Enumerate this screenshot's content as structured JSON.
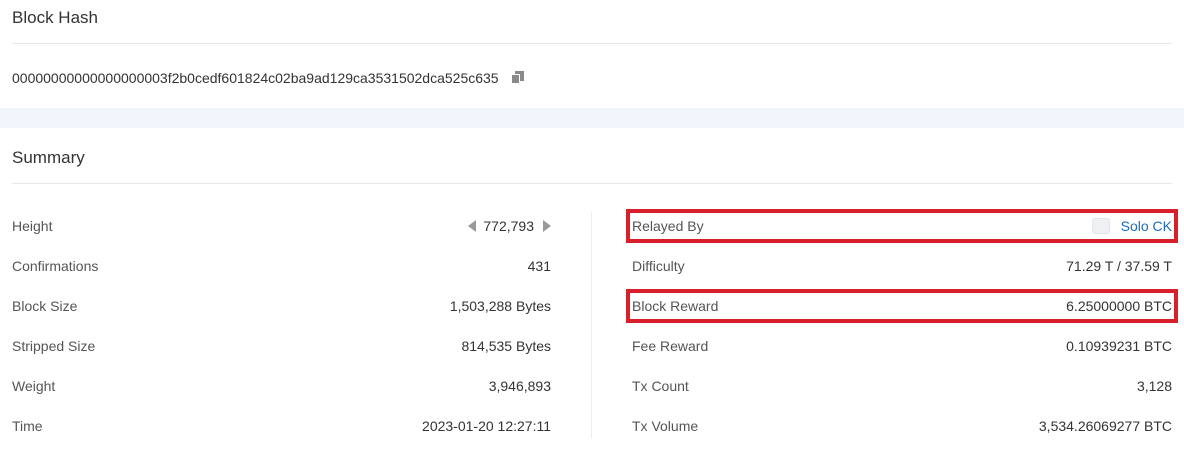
{
  "block_hash": {
    "title": "Block Hash",
    "value": "00000000000000000003f2b0cedf601824c02ba9ad129ca3531502dca525c635",
    "copy_icon": "copy-icon"
  },
  "summary": {
    "title": "Summary",
    "left": [
      {
        "label": "Height",
        "value": "772,793"
      },
      {
        "label": "Confirmations",
        "value": "431"
      },
      {
        "label": "Block Size",
        "value": "1,503,288 Bytes"
      },
      {
        "label": "Stripped Size",
        "value": "814,535 Bytes"
      },
      {
        "label": "Weight",
        "value": "3,946,893"
      },
      {
        "label": "Time",
        "value": "2023-01-20 12:27:11"
      }
    ],
    "right": [
      {
        "label": "Relayed By",
        "value": "Solo CK"
      },
      {
        "label": "Difficulty",
        "value": "71.29 T / 37.59 T"
      },
      {
        "label": "Block Reward",
        "value": "6.25000000 BTC"
      },
      {
        "label": "Fee Reward",
        "value": "0.10939231 BTC"
      },
      {
        "label": "Tx Count",
        "value": "3,128"
      },
      {
        "label": "Tx Volume",
        "value": "3,534.26069277 BTC"
      }
    ]
  },
  "colors": {
    "highlight": "#d8202c",
    "link": "#1e6bb8",
    "band": "#f1f6fd"
  }
}
